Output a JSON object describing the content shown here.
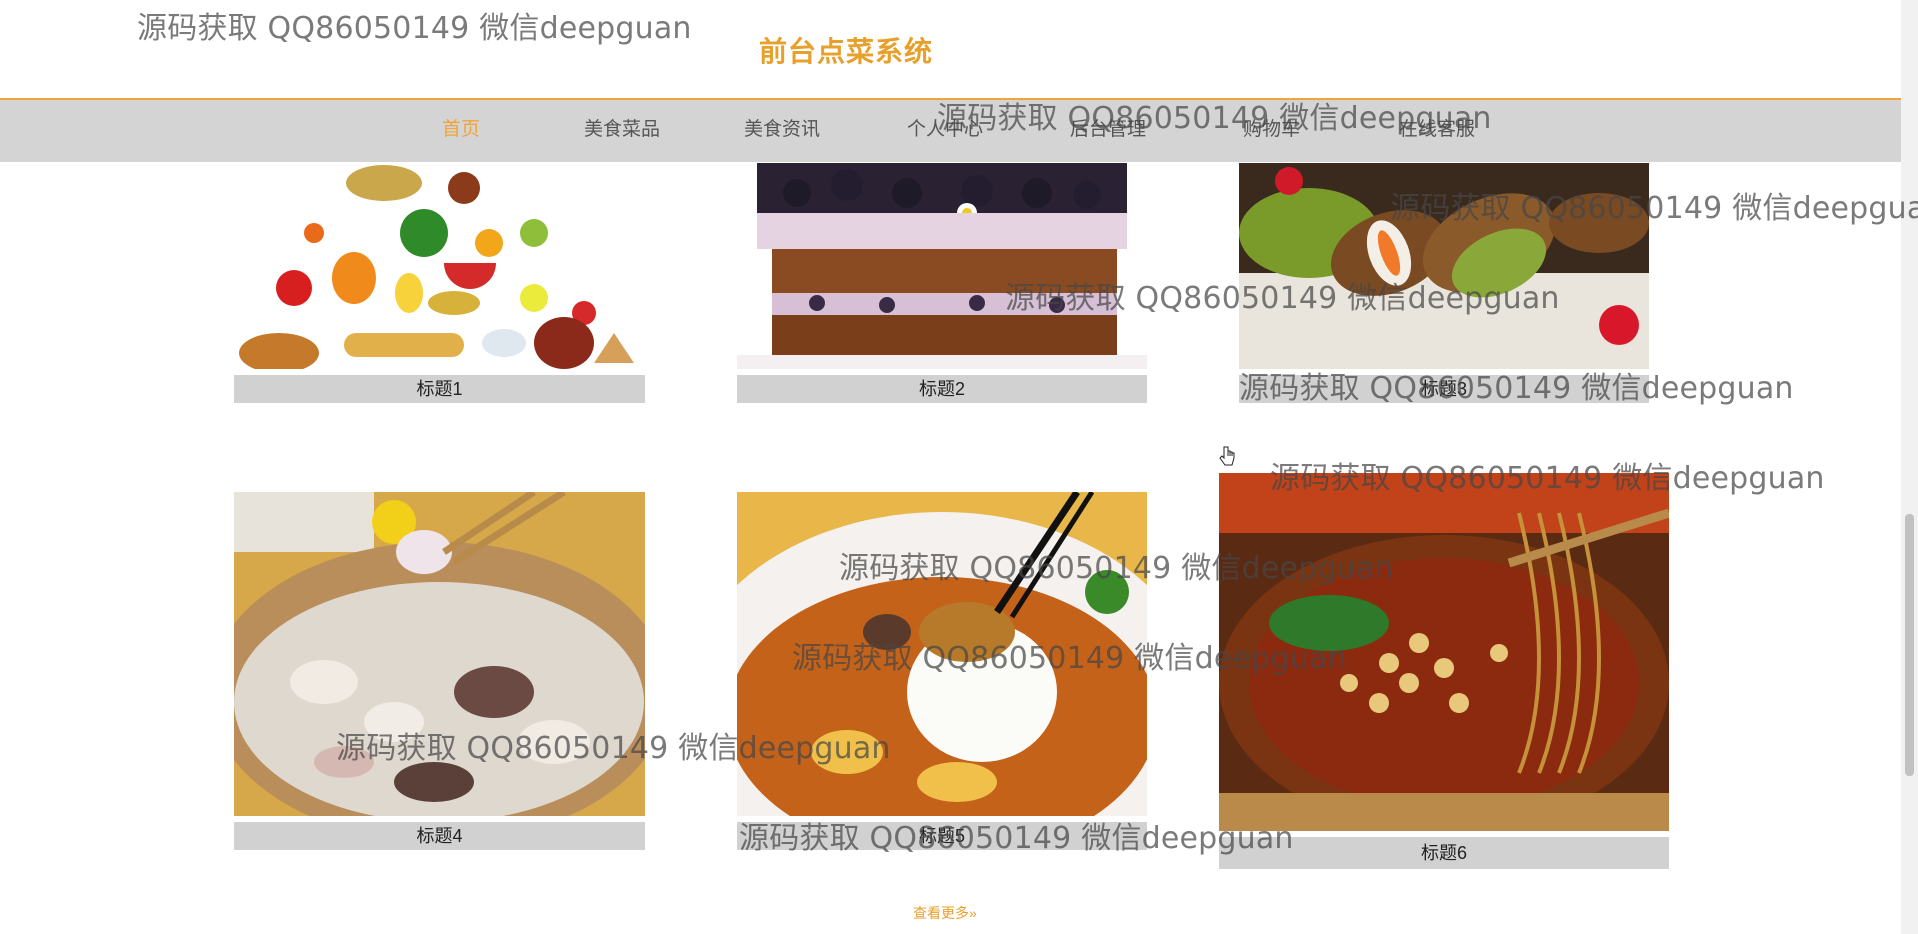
{
  "header": {
    "title": "前台点菜系统"
  },
  "nav": {
    "items": [
      {
        "label": "首页",
        "active": true
      },
      {
        "label": "美食菜品"
      },
      {
        "label": "美食资讯"
      },
      {
        "label": "个人中心"
      },
      {
        "label": "后台管理"
      },
      {
        "label": "购物车"
      },
      {
        "label": "在线客服"
      }
    ]
  },
  "cards": [
    {
      "caption": "标题1",
      "image": "food-pyramid-image"
    },
    {
      "caption": "标题2",
      "image": "blackberry-cake-image"
    },
    {
      "caption": "标题3",
      "image": "cannoli-image"
    },
    {
      "caption": "标题4",
      "image": "lotus-root-soup-image"
    },
    {
      "caption": "标题5",
      "image": "abalone-rice-image"
    },
    {
      "caption": "标题6",
      "image": "spicy-noodles-image"
    }
  ],
  "more_link": "查看更多»",
  "watermark": "源码获取 QQ86050149 微信deepguan",
  "colors": {
    "accent": "#e8a02c",
    "nav_bg": "#d4d4d4",
    "caption_bg": "#d1d1d1"
  }
}
